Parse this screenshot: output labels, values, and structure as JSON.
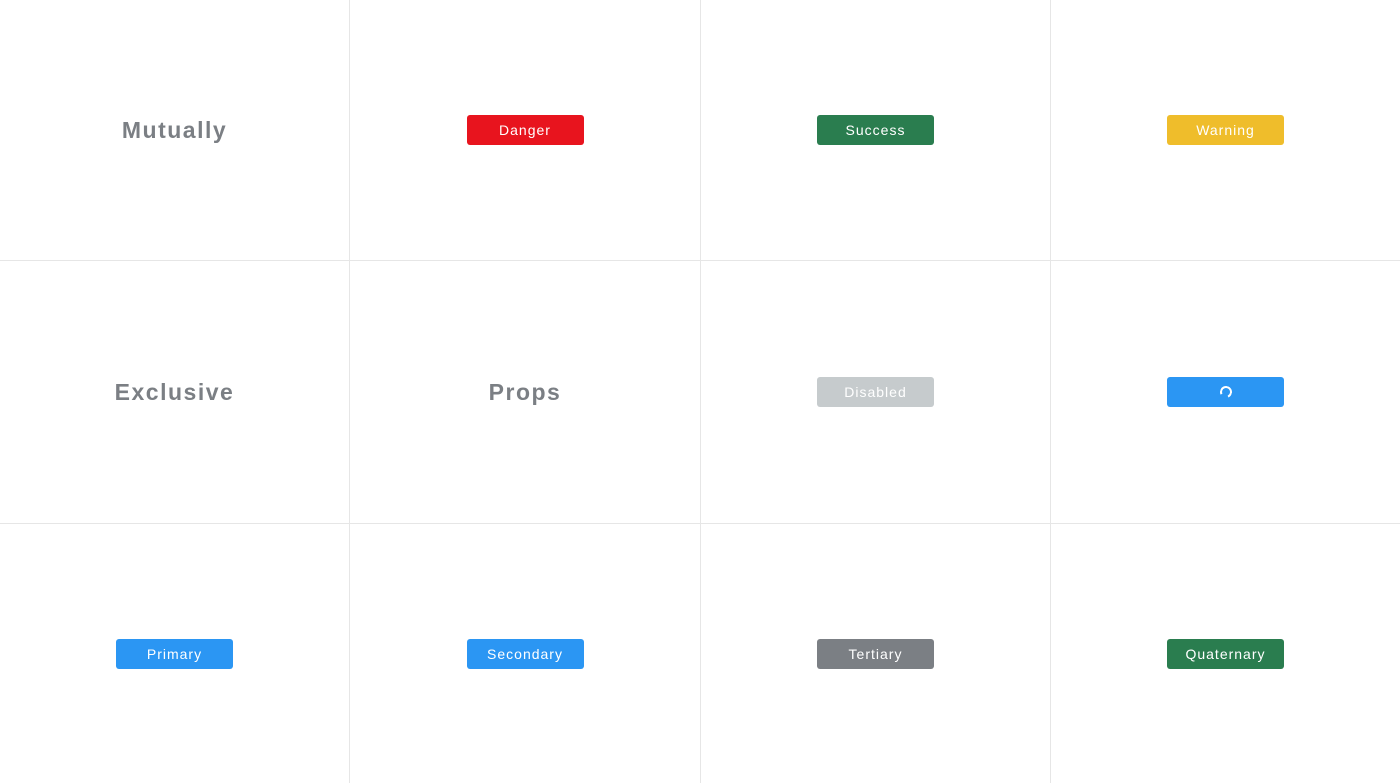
{
  "headings": {
    "row1": "Mutually",
    "row2": "Exclusive",
    "props": "Props"
  },
  "buttons": {
    "danger": {
      "label": "Danger",
      "color": "#e8141e"
    },
    "success": {
      "label": "Success",
      "color": "#2a7d4f"
    },
    "warning": {
      "label": "Warning",
      "color": "#efbd2b"
    },
    "disabled": {
      "label": "Disabled",
      "color": "#c6cbcd"
    },
    "loading": {
      "icon": "loading-spinner-icon",
      "color": "#2b96f3"
    },
    "primary": {
      "label": "Primary",
      "color": "#2b96f3"
    },
    "secondary": {
      "label": "Secondary",
      "color": "#2b96f3"
    },
    "tertiary": {
      "label": "Tertiary",
      "color": "#7b7f84"
    },
    "quaternary": {
      "label": "Quaternary",
      "color": "#2a7d4f"
    }
  },
  "colors": {
    "heading_text": "#7b7f84",
    "grid_line": "#e6e6e6",
    "background": "#ffffff"
  }
}
